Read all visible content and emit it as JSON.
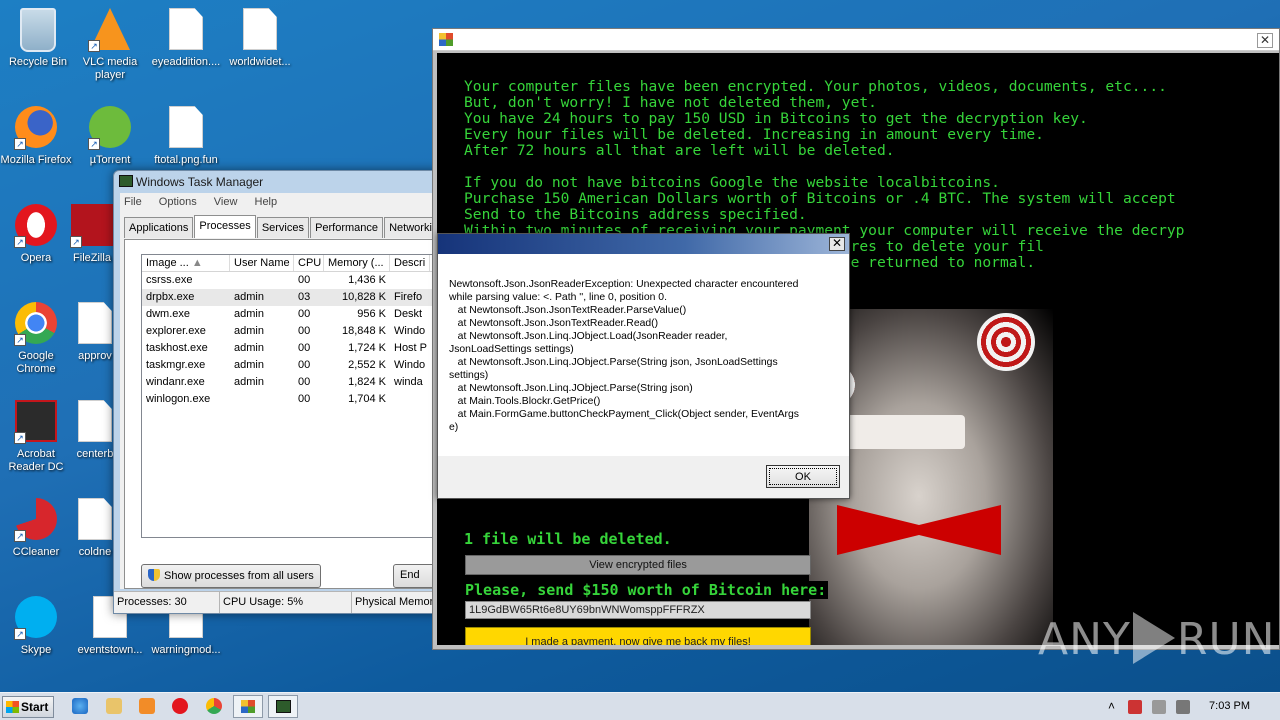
{
  "desktop": {
    "icons": [
      {
        "label": "Recycle Bin"
      },
      {
        "label": "VLC media player"
      },
      {
        "label": "eyeaddition...."
      },
      {
        "label": "worldwidet..."
      },
      {
        "label": "Mozilla Firefox"
      },
      {
        "label": "µTorrent"
      },
      {
        "label": "ftotal.png.fun"
      },
      {
        "label": "Opera"
      },
      {
        "label": "FileZilla"
      },
      {
        "label": "Google Chrome"
      },
      {
        "label": "approv"
      },
      {
        "label": "Acrobat Reader DC"
      },
      {
        "label": "centerb"
      },
      {
        "label": "CCleaner"
      },
      {
        "label": "coldne"
      },
      {
        "label": "Skype"
      },
      {
        "label": "eventstown..."
      },
      {
        "label": "warningmod..."
      }
    ]
  },
  "task_manager": {
    "title": "Windows Task Manager",
    "menu": [
      "File",
      "Options",
      "View",
      "Help"
    ],
    "tabs": [
      "Applications",
      "Processes",
      "Services",
      "Performance",
      "Networking"
    ],
    "columns": [
      "Image ...",
      "User Name",
      "CPU",
      "Memory (...",
      "Descri"
    ],
    "rows": [
      [
        "csrss.exe",
        "",
        "00",
        "1,436 K",
        ""
      ],
      [
        "drpbx.exe",
        "admin",
        "03",
        "10,828 K",
        "Firefo"
      ],
      [
        "dwm.exe",
        "admin",
        "00",
        "956 K",
        "Deskt"
      ],
      [
        "explorer.exe",
        "admin",
        "00",
        "18,848 K",
        "Windo"
      ],
      [
        "taskhost.exe",
        "admin",
        "00",
        "1,724 K",
        "Host P"
      ],
      [
        "taskmgr.exe",
        "admin",
        "00",
        "2,552 K",
        "Windo"
      ],
      [
        "windanr.exe",
        "admin",
        "00",
        "1,824 K",
        "winda"
      ],
      [
        "winlogon.exe",
        "",
        "00",
        "1,704 K",
        ""
      ]
    ],
    "show_all_button": "Show processes from all users",
    "end_button": "End",
    "status": {
      "processes": "Processes: 30",
      "cpu": "CPU Usage: 5%",
      "memory": "Physical Memory"
    }
  },
  "ransom_window": {
    "message_lines": [
      "Your computer files have been encrypted. Your photos, videos, documents, etc....",
      "But, don't worry! I have not deleted them, yet.",
      "You have 24 hours to pay 150 USD in Bitcoins to get the decryption key.",
      "Every hour files will be deleted. Increasing in amount every time.",
      "After 72 hours all that are left will be deleted.",
      "",
      "If you do not have bitcoins Google the website localbitcoins.",
      "Purchase 150 American Dollars worth of Bitcoins or .4 BTC. The system will accept",
      "Send to the Bitcoins address specified.",
      "Within two minutes of receiving your payment your computer will receive the decryp",
      "                        several safety measures to delete your fil",
      "                        crypted files will be returned to normal."
    ],
    "deleted_notice": "1 file will be deleted.",
    "view_button": "View encrypted files",
    "send_text": "Please, send $150 worth of Bitcoin here:",
    "address": "1L9GdBW65Rt6e8UY69bnWNWomsppFFFRZX",
    "pay_button": "I made a payment, now give me back my files!"
  },
  "error_dialog": {
    "close_glyph": "✕",
    "message": "Newtonsoft.Json.JsonReaderException: Unexpected character encountered\nwhile parsing value: <. Path '', line 0, position 0.\n   at Newtonsoft.Json.JsonTextReader.ParseValue()\n   at Newtonsoft.Json.JsonTextReader.Read()\n   at Newtonsoft.Json.Linq.JObject.Load(JsonReader reader,\nJsonLoadSettings settings)\n   at Newtonsoft.Json.Linq.JObject.Parse(String json, JsonLoadSettings\nsettings)\n   at Newtonsoft.Json.Linq.JObject.Parse(String json)\n   at Main.Tools.Blockr.GetPrice()\n   at Main.FormGame.buttonCheckPayment_Click(Object sender, EventArgs\ne)",
    "ok_button": "OK"
  },
  "watermark": {
    "left": "ANY",
    "right": "RUN"
  },
  "taskbar": {
    "start_label": "Start",
    "clock": "7:03 PM"
  }
}
